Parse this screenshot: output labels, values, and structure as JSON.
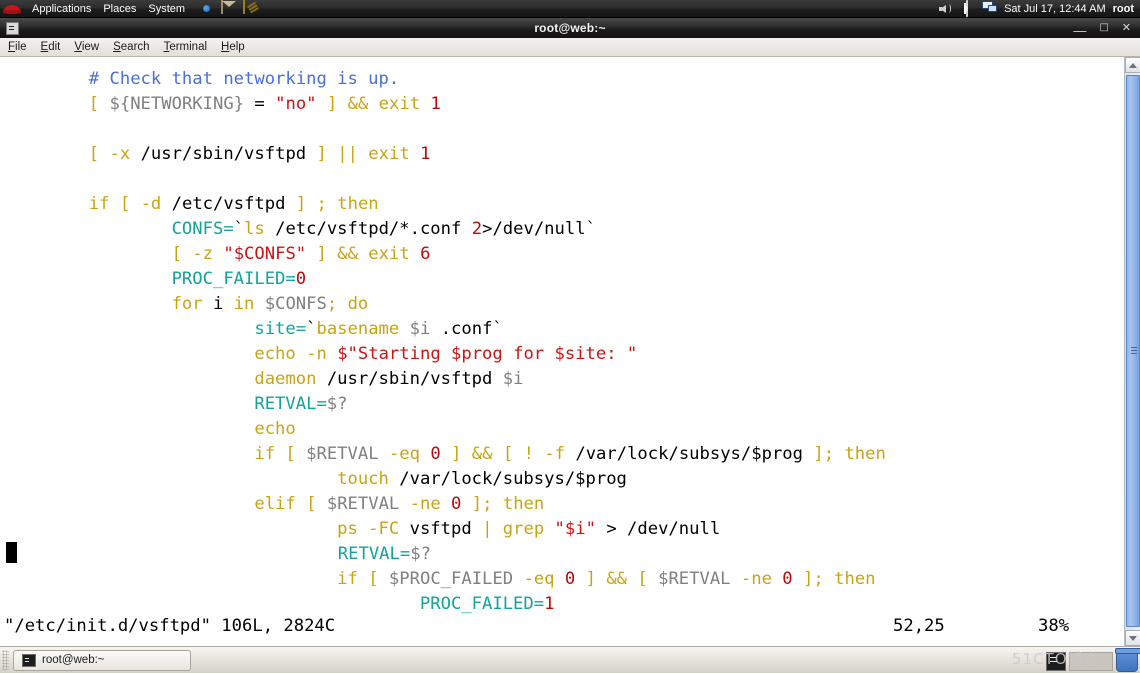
{
  "panel": {
    "logo_icon": "redhat-logo",
    "menus": [
      "Applications",
      "Places",
      "System"
    ],
    "launchers": [
      {
        "name": "firefox-icon",
        "label": "Firefox"
      },
      {
        "name": "mail-icon",
        "label": "Evolution Mail"
      },
      {
        "name": "notepad-icon",
        "label": "Text Editor"
      }
    ],
    "tray": [
      {
        "name": "volume-icon"
      },
      {
        "name": "bluetooth-icon"
      },
      {
        "name": "network-icon"
      }
    ],
    "clock": "Sat Jul 17, 12:44 AM",
    "user": "root"
  },
  "window": {
    "title": "root@web:~",
    "icon": "terminal-icon",
    "buttons": {
      "minimize": "—",
      "maximize": "□",
      "close": "✕"
    },
    "menubar": [
      {
        "mnemonic": "F",
        "rest": "ile"
      },
      {
        "mnemonic": "E",
        "rest": "dit"
      },
      {
        "mnemonic": "V",
        "rest": "iew"
      },
      {
        "mnemonic": "S",
        "rest": "earch"
      },
      {
        "mnemonic": "T",
        "rest": "erminal"
      },
      {
        "mnemonic": "H",
        "rest": "elp"
      }
    ]
  },
  "editor": {
    "lines": [
      "        # Check that networking is up.",
      "        [ ${NETWORKING} = \"no\" ] && exit 1",
      "",
      "        [ -x /usr/sbin/vsftpd ] || exit 1",
      "",
      "        if [ -d /etc/vsftpd ] ; then",
      "                CONFS=`ls /etc/vsftpd/*.conf 2>/dev/null`",
      "                [ -z \"$CONFS\" ] && exit 6",
      "                PROC_FAILED=0",
      "                for i in $CONFS; do",
      "                        site=`basename $i .conf`",
      "                        echo -n $\"Starting $prog for $site: \"",
      "                        daemon /usr/sbin/vsftpd $i",
      "                        RETVAL=$?",
      "                        echo",
      "                        if [ $RETVAL -eq 0 ] && [ ! -f /var/lock/subsys/$prog ]; then",
      "                                touch /var/lock/subsys/$prog",
      "                        elif [ $RETVAL -ne 0 ]; then",
      "                                ps -FC vsftpd | grep \"$i\" > /dev/null",
      "                                RETVAL=$?",
      "                                if [ $PROC_FAILED -eq 0 ] && [ $RETVAL -ne 0 ]; then",
      "                                        PROC_FAILED=1"
    ],
    "cursor_block": "█",
    "statusline": {
      "file": "\"/etc/init.d/vsftpd\" 106L, 2824C",
      "position": "52,25",
      "percent": "38%"
    }
  },
  "scrollbar": {
    "up_arrow": "scroll-up-icon",
    "down_arrow": "scroll-down-icon"
  },
  "taskbar": {
    "window_button": {
      "label": "root@web:~",
      "icon": "terminal-icon"
    },
    "tray": [
      {
        "name": "terminal-tray-icon"
      },
      {
        "name": "blank-tray-item"
      },
      {
        "name": "trash-icon"
      }
    ]
  },
  "watermark": "51CTO博客",
  "colors": {
    "comment": "#4a6fd4",
    "keyword": "#c8a414",
    "string": "#cc1414",
    "number": "#b80b0b",
    "identifier": "#808080",
    "assignment": "#13a39a",
    "plain": "#000000",
    "terminal_bg": "#ffffff",
    "scrollbar": "#8fb3e8"
  }
}
